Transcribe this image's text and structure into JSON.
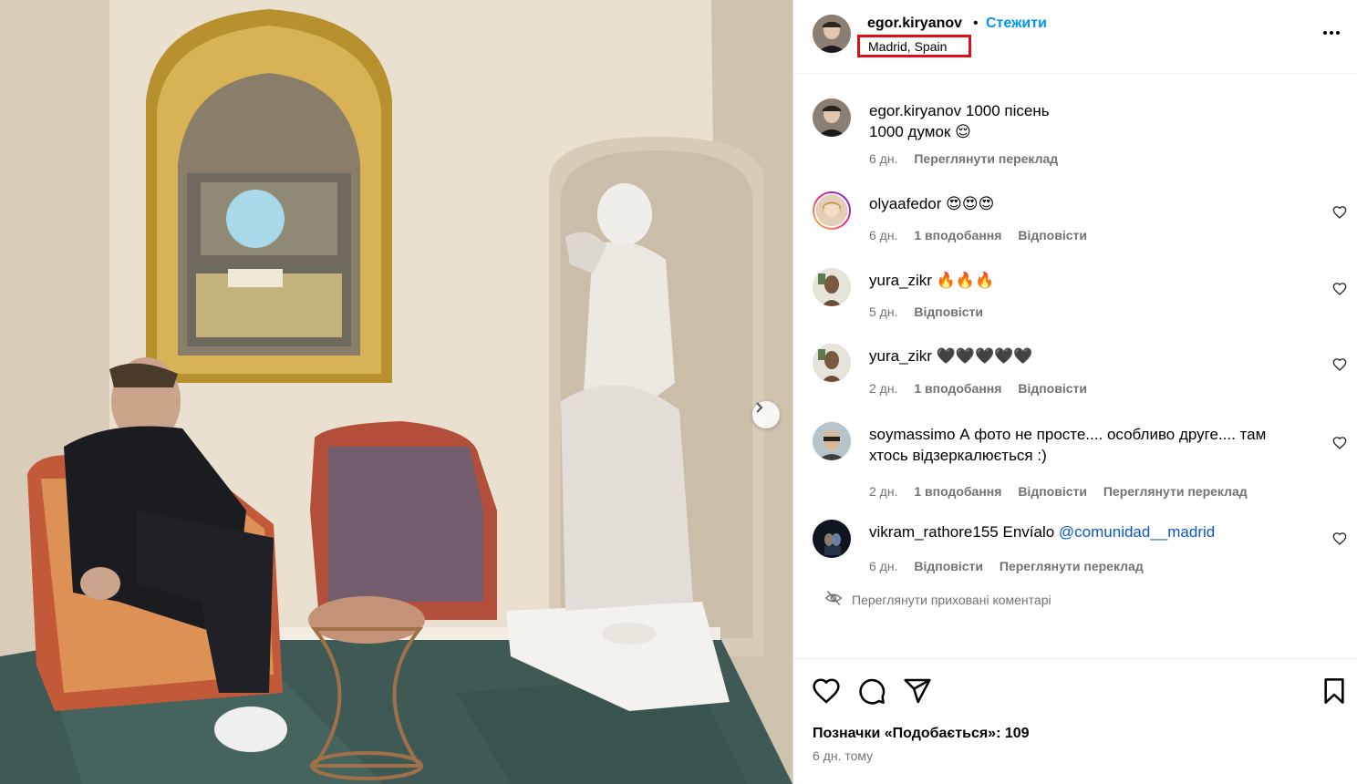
{
  "post": {
    "username": "egor.kiryanov",
    "follow_label": "Стежити",
    "separator": "•",
    "location": "Madrid, Spain",
    "more_icon": "more-horizontal-icon"
  },
  "caption": {
    "username": "egor.kiryanov",
    "line1": "1000 пісень",
    "line2": "1000 думок 😌",
    "time": "6 дн.",
    "translate": "Переглянути переклад"
  },
  "comments": [
    {
      "username": "olyaafedor",
      "text": "😍😍😍",
      "time": "6 дн.",
      "likes": "1 вподобання",
      "reply": "Відповісти",
      "translate": ""
    },
    {
      "username": "yura_zikr",
      "text": "🔥🔥🔥",
      "time": "5 дн.",
      "likes": "",
      "reply": "Відповісти",
      "translate": ""
    },
    {
      "username": "yura_zikr",
      "text": "🖤🖤🖤🖤🖤",
      "time": "2 дн.",
      "likes": "1 вподобання",
      "reply": "Відповісти",
      "translate": ""
    },
    {
      "username": "soymassimo",
      "text": "А фото не просте.... особливо друге.... там хтось відзеркалюється :)",
      "time": "2 дн.",
      "likes": "1 вподобання",
      "reply": "Відповісти",
      "translate": "Переглянути переклад"
    },
    {
      "username": "vikram_rathore155",
      "text": "Envíalo",
      "mention": "@comunidad__madrid",
      "time": "6 дн.",
      "likes": "",
      "reply": "Відповісти",
      "translate": "Переглянути переклад"
    }
  ],
  "hidden_comments": "Переглянути приховані коментарі",
  "likes_label": "Позначки «Подобається»: 109",
  "posted": "6 дн. тому",
  "icons": [
    "heart-icon",
    "comment-icon",
    "share-icon",
    "bookmark-icon",
    "chevron-right-icon"
  ]
}
